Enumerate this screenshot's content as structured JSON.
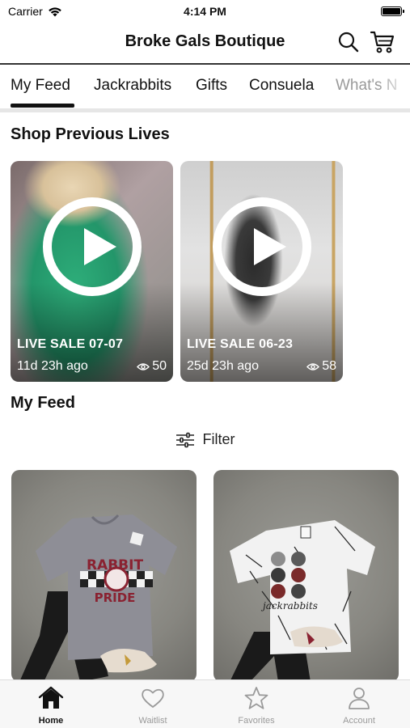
{
  "status": {
    "carrier": "Carrier",
    "time": "4:14 PM"
  },
  "header": {
    "title": "Broke Gals Boutique"
  },
  "tabs": [
    {
      "label": "My Feed",
      "active": true
    },
    {
      "label": "Jackrabbits"
    },
    {
      "label": "Gifts"
    },
    {
      "label": "Consuela"
    },
    {
      "label": "What's N"
    }
  ],
  "previous_lives": {
    "title": "Shop Previous Lives",
    "items": [
      {
        "label": "LIVE SALE 07-07",
        "ago": "11d 23h ago",
        "views": "50"
      },
      {
        "label": "LIVE SALE 06-23",
        "ago": "25d 23h ago",
        "views": "58"
      }
    ]
  },
  "feed": {
    "title": "My Feed",
    "filter_label": "Filter",
    "products": [
      {
        "shirt_text_top": "RABBIT",
        "shirt_text_bottom": "PRIDE",
        "shirt_color": "#8e8e96"
      },
      {
        "shirt_text_bottom": "jackrabbits",
        "shirt_color": "#f2f2f2"
      }
    ]
  },
  "tabbar": {
    "items": [
      {
        "label": "Home",
        "icon": "home-icon",
        "active": true
      },
      {
        "label": "Waitlist",
        "icon": "heart-icon"
      },
      {
        "label": "Favorites",
        "icon": "star-icon"
      },
      {
        "label": "Account",
        "icon": "person-icon"
      }
    ]
  }
}
